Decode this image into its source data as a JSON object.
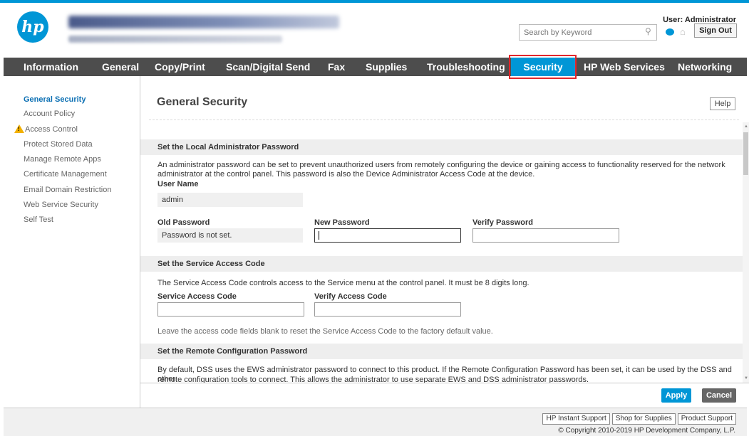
{
  "header": {
    "logo_text": "hp",
    "search_placeholder": "Search by Keyword",
    "user_label": "User: Administrator",
    "sign_out": "Sign Out"
  },
  "nav": {
    "tabs": [
      {
        "label": "Information"
      },
      {
        "label": "General"
      },
      {
        "label": "Copy/Print"
      },
      {
        "label": "Scan/Digital Send"
      },
      {
        "label": "Fax"
      },
      {
        "label": "Supplies"
      },
      {
        "label": "Troubleshooting"
      },
      {
        "label": "Security",
        "active": true
      },
      {
        "label": "HP Web Services"
      },
      {
        "label": "Networking"
      }
    ]
  },
  "sidebar": {
    "items": [
      {
        "label": "General Security",
        "active": true
      },
      {
        "label": "Account Policy"
      },
      {
        "label": "Access Control",
        "warning": true
      },
      {
        "label": "Protect Stored Data"
      },
      {
        "label": "Manage Remote Apps"
      },
      {
        "label": "Certificate Management"
      },
      {
        "label": "Email Domain Restriction"
      },
      {
        "label": "Web Service Security"
      },
      {
        "label": "Self Test"
      }
    ]
  },
  "main": {
    "title": "General Security",
    "help": "Help",
    "admin_section": {
      "heading": "Set the Local Administrator Password",
      "desc_line1": "An administrator password can be set to prevent unauthorized users from remotely configuring the device or gaining access to functionality reserved for the network",
      "desc_line2": "administrator at the control panel. This password is also the Device Administrator Access Code at the device.",
      "username_label": "User Name",
      "username_value": "admin",
      "old_password_label": "Old Password",
      "old_password_value": "Password is not set.",
      "new_password_label": "New Password",
      "verify_password_label": "Verify Password"
    },
    "service_section": {
      "heading": "Set the Service Access Code",
      "desc": "The Service Access Code controls access to the Service menu at the control panel. It must be 8 digits long.",
      "code_label": "Service Access Code",
      "verify_label": "Verify Access Code",
      "note": "Leave the access code fields blank to reset the Service Access Code to the factory default value."
    },
    "remote_section": {
      "heading": "Set the Remote Configuration Password",
      "desc_line1": "By default, DSS uses the EWS administrator password to connect to this product. If the Remote Configuration Password has been set, it can be used by the DSS and other",
      "desc_line2": "remote configuration tools to connect. This allows the administrator to use separate EWS and DSS administrator passwords."
    },
    "apply": "Apply",
    "cancel": "Cancel"
  },
  "footer": {
    "links": [
      "HP Instant Support",
      "Shop for Supplies",
      "Product Support"
    ],
    "copyright": "© Copyright 2010-2019 HP Development Company, L.P."
  },
  "colors": {
    "accent": "#0096d6",
    "nav_bg": "#4d4d4d",
    "highlight": "#e2262b"
  }
}
